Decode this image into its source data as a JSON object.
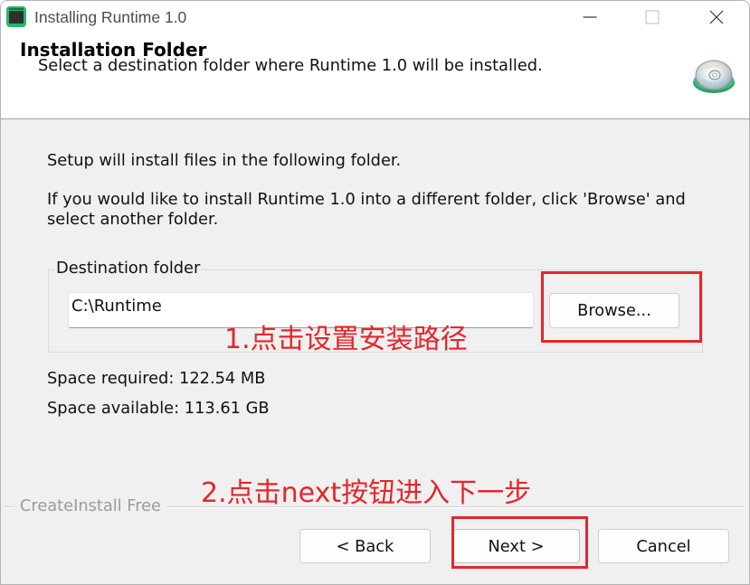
{
  "window": {
    "title": "Installing Runtime 1.0",
    "app_icon": "app-icon",
    "controls": [
      "minimize-icon",
      "maximize-icon",
      "close-icon"
    ]
  },
  "header": {
    "title": "Installation Folder",
    "subtitle": "Select a destination folder where Runtime 1.0 will be installed.",
    "icon": "cd-disc-icon"
  },
  "body": {
    "intro": "Setup will install files in the following folder.",
    "instructions": [
      "If you would like to install Runtime 1.0 into a different folder, click 'Browse' and",
      "select another folder."
    ]
  },
  "destination": {
    "group_label": "Destination folder",
    "path_value": "C:\\Runtime",
    "browse_label": "Browse..."
  },
  "space": {
    "required_label": "Space required:",
    "required_value": "122.54 MB",
    "available_label": "Space available:",
    "available_value": "113.61 GB"
  },
  "footer": {
    "brand": "CreateInstall Free",
    "back_label": "< Back",
    "next_label": "Next >",
    "cancel_label": "Cancel"
  },
  "annotations": [
    {
      "text": "1.点击设置安装路径"
    },
    {
      "text": "2.点击next按钮进入下一步"
    }
  ],
  "colors": {
    "annotation_red": "#e5262b",
    "dialog_bg": "#f0f0f0",
    "header_bg": "#ffffff",
    "brand_gray": "#9b9b9b",
    "app_icon_green": "#27b866"
  }
}
